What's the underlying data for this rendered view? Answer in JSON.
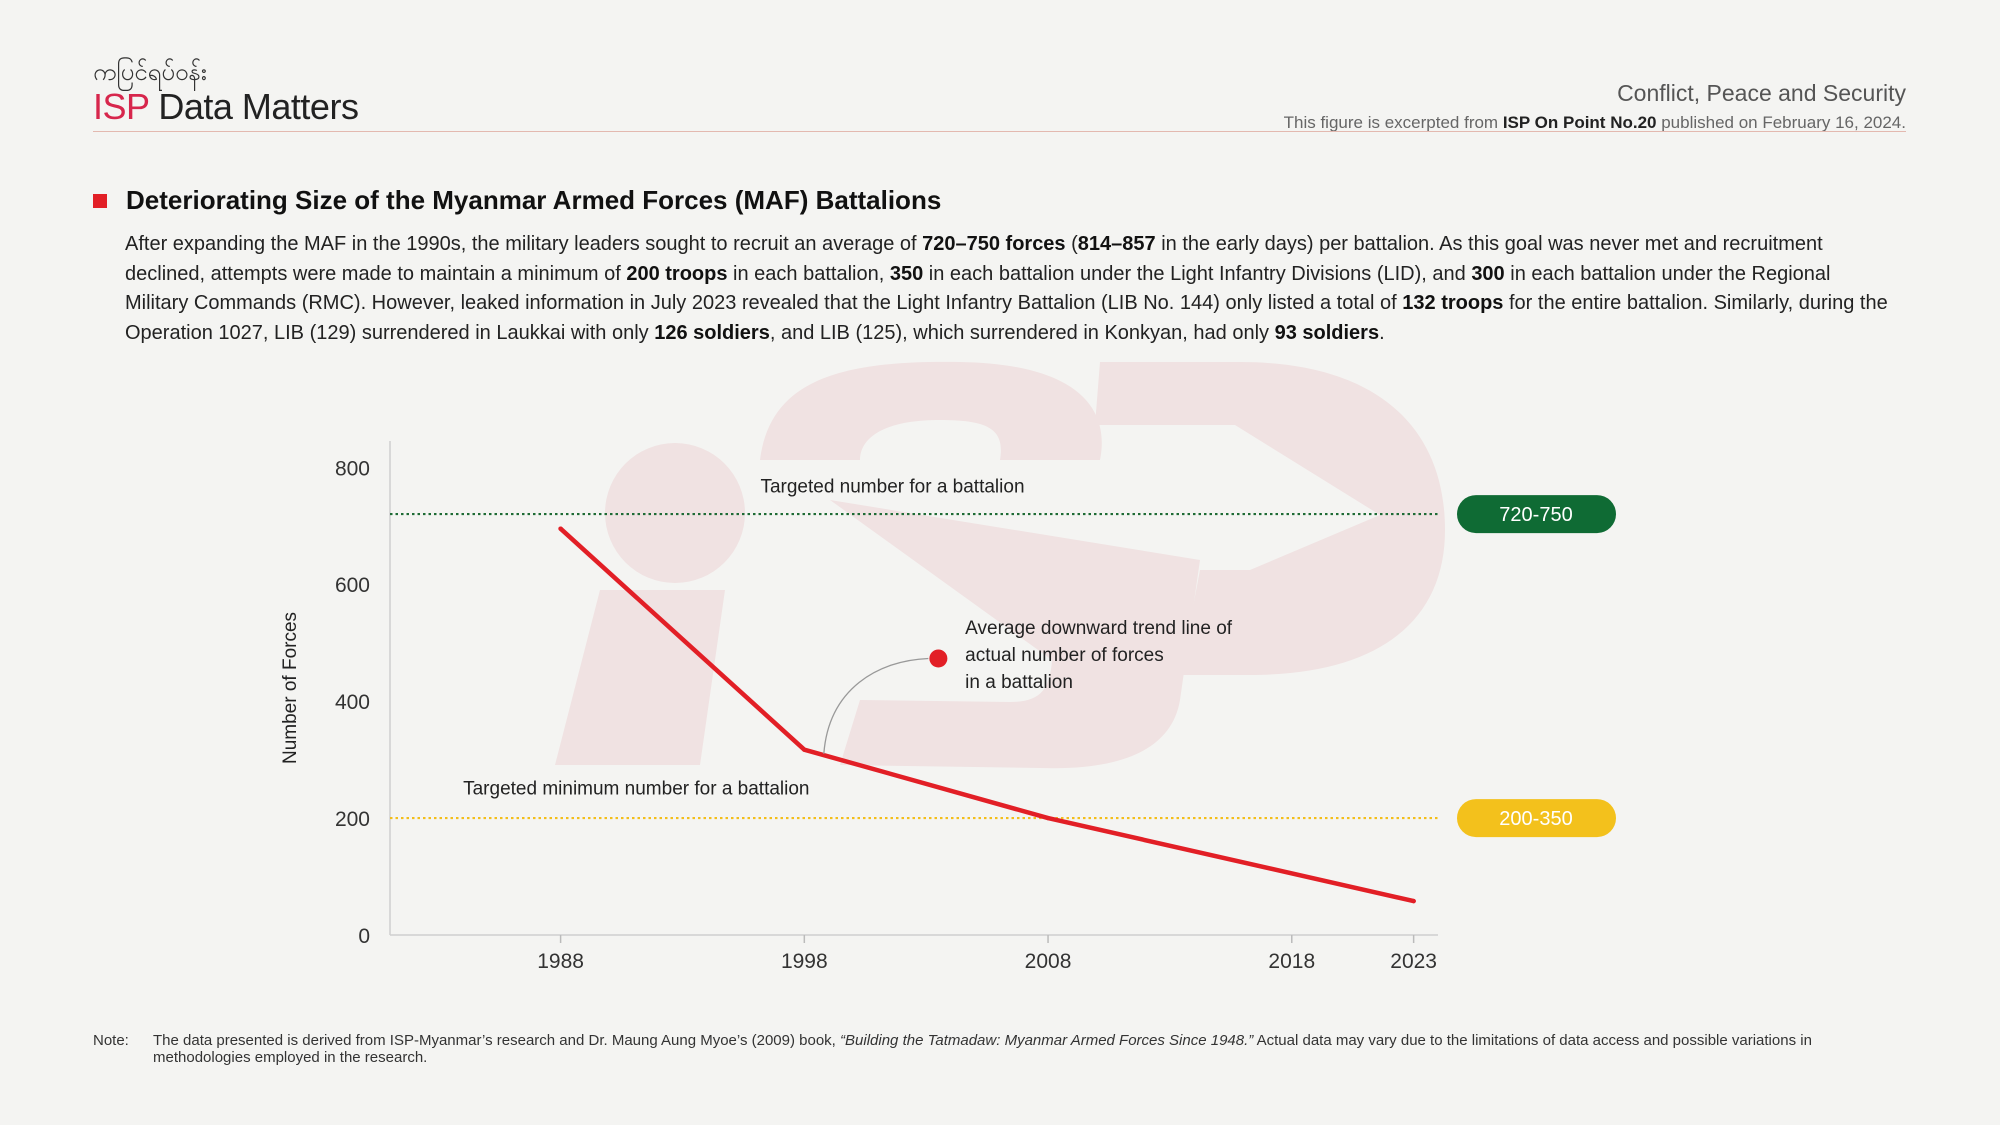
{
  "header": {
    "brand_top": "ကပြင်ရပ်ဝန်း",
    "brand_isp": "ISP",
    "brand_rest": " Data Matters",
    "category": "Conflict, Peace and Security",
    "source_pre": "This figure is excerpted from ",
    "source_bold": "ISP On Point No.20",
    "source_post": " published on February 16, 2024."
  },
  "section": {
    "title": "Deteriorating Size of the Myanmar Armed Forces (MAF) Battalions",
    "paragraph": [
      {
        "t": "After expanding the MAF in the 1990s, the military leaders sought to recruit an average of ",
        "b": false
      },
      {
        "t": "720–750 forces",
        "b": true
      },
      {
        "t": " (",
        "b": false
      },
      {
        "t": "814–857",
        "b": true
      },
      {
        "t": " in the early days) per battalion. As this goal was never met and recruitment declined, attempts were made to maintain a minimum of ",
        "b": false
      },
      {
        "t": "200 troops",
        "b": true
      },
      {
        "t": " in each battalion, ",
        "b": false
      },
      {
        "t": "350",
        "b": true
      },
      {
        "t": " in each battalion under the Light Infantry Divisions (LID), and ",
        "b": false
      },
      {
        "t": "300",
        "b": true
      },
      {
        "t": " in each battalion under the Regional Military Commands (RMC). However, leaked information in July 2023 revealed that the Light Infantry Battalion (LIB No. 144) only listed a total of ",
        "b": false
      },
      {
        "t": "132 troops",
        "b": true
      },
      {
        "t": " for the entire battalion. Similarly, during the Operation 1027, LIB (129) surrendered in Laukkai with only ",
        "b": false
      },
      {
        "t": "126 soldiers",
        "b": true
      },
      {
        "t": ", and LIB (125), which surrendered in Konkyan, had only ",
        "b": false
      },
      {
        "t": "93 soldiers",
        "b": true
      },
      {
        "t": ".",
        "b": false
      }
    ]
  },
  "chart_data": {
    "type": "line",
    "ylabel": "Number of Forces",
    "xlabel": "",
    "xlim": [
      1981,
      2024
    ],
    "ylim": [
      0,
      845
    ],
    "y_ticks": [
      0,
      200,
      400,
      600,
      800
    ],
    "x_ticks": [
      1988,
      1998,
      2008,
      2018,
      2023
    ],
    "series": [
      {
        "color": "#e21f26",
        "x": [
          1988,
          1998,
          2008,
          2023
        ],
        "y": [
          695,
          317,
          200,
          58
        ]
      }
    ],
    "reference_lines": [
      {
        "y": 720,
        "label": "Targeted number for a battalion",
        "badge": "720-750",
        "color": "#1e6b35",
        "badge_color": "#0f6b34",
        "label_x": 1996.2,
        "label_y": 757
      },
      {
        "y": 200,
        "label": "Targeted minimum number for a battalion",
        "badge": "200-350",
        "color": "#f3be1a",
        "badge_color": "#f3c11c",
        "label_x": 1984,
        "label_y": 240
      }
    ],
    "annotation": {
      "lines": [
        "Average downward  trend line of",
        "actual number of forces",
        "in a battalion"
      ],
      "marker_x": 2003.5,
      "marker_y": 473,
      "anchor_x": 1998.8,
      "anchor_y": 310,
      "text_x": 2004.6,
      "text_y": 515
    },
    "grid": false
  },
  "note": {
    "label": "Note:",
    "pre": "The data presented is derived from ISP-Myanmar’s research and Dr. Maung Aung Myoe’s (2009) book, ",
    "italic": "“Building the Tatmadaw: Myanmar Armed Forces Since 1948.”",
    "post": " Actual data may vary due to the limitations of data access and possible variations in methodologies employed in the research."
  }
}
